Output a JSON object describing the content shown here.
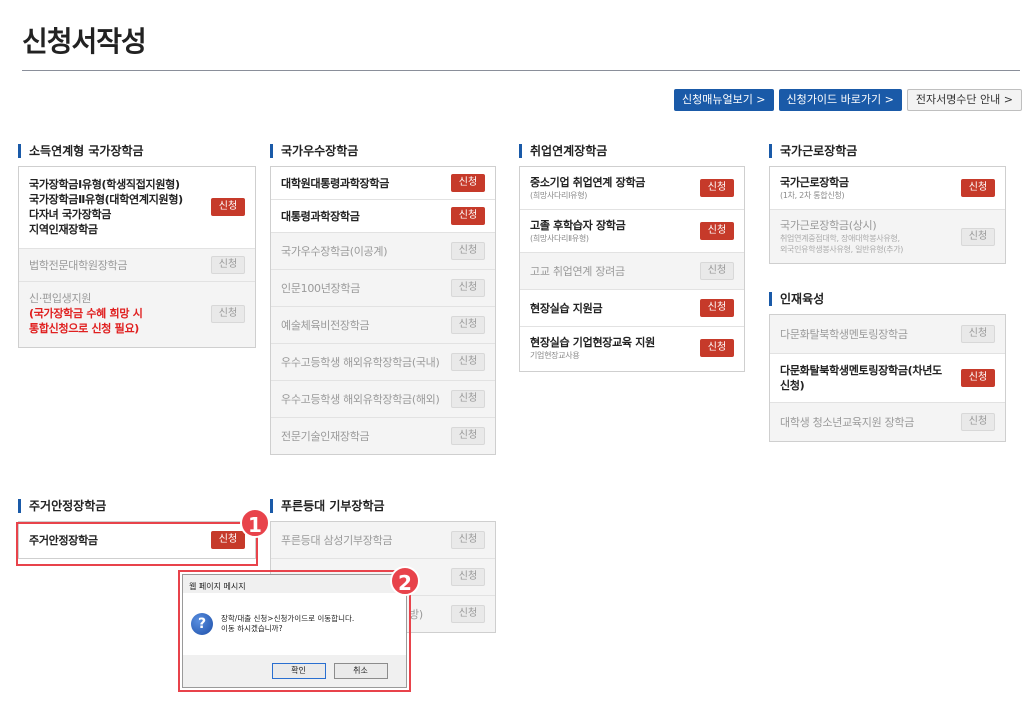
{
  "page": {
    "title": "신청서작성"
  },
  "top_buttons": [
    {
      "label": "신청매뉴얼보기 >",
      "style": "blue"
    },
    {
      "label": "신청가이드 바로가기 >",
      "style": "blue"
    },
    {
      "label": "전자서명수단 안내 >",
      "style": "gray"
    }
  ],
  "sections": {
    "income": {
      "title": "소득연계형 국가장학금",
      "main": {
        "label": "국가장학금Ⅰ유형(학생직접지원형)\n국가장학금Ⅱ유형(대학연계지원형)\n다자녀 국가장학금\n지역인재장학금",
        "button": "신청"
      },
      "law": {
        "label": "법학전문대학원장학금",
        "button": "신청"
      },
      "transfer": {
        "label": "신·편입생지원",
        "note": "(국가장학금 수혜 희망 시\n통합신청으로 신청 필요)",
        "button": "신청"
      }
    },
    "excellence": {
      "title": "국가우수장학금",
      "items": [
        {
          "label": "대학원대통령과학장학금",
          "button": "신청",
          "active": true
        },
        {
          "label": "대통령과학장학금",
          "button": "신청",
          "active": true
        },
        {
          "label": "국가우수장학금(이공계)",
          "button": "신청",
          "active": false
        },
        {
          "label": "인문100년장학금",
          "button": "신청",
          "active": false
        },
        {
          "label": "예술체육비전장학금",
          "button": "신청",
          "active": false
        },
        {
          "label": "우수고등학생 해외유학장학금(국내)",
          "button": "신청",
          "active": false
        },
        {
          "label": "우수고등학생 해외유학장학금(해외)",
          "button": "신청",
          "active": false
        },
        {
          "label": "전문기술인재장학금",
          "button": "신청",
          "active": false
        }
      ]
    },
    "employment": {
      "title": "취업연계장학금",
      "items": [
        {
          "label": "중소기업 취업연계 장학금",
          "sub": "(희망사다리Ⅰ유형)",
          "button": "신청",
          "active": true
        },
        {
          "label": "고졸 후학습자 장학금",
          "sub": "(희망사다리Ⅱ유형)",
          "button": "신청",
          "active": true
        },
        {
          "label": "고교 취업연계 장려금",
          "sub": "",
          "button": "신청",
          "active": false
        },
        {
          "label": "현장실습 지원금",
          "sub": "",
          "button": "신청",
          "active": true
        },
        {
          "label": "현장실습 기업현장교육 지원",
          "sub": "기업현장교사용",
          "button": "신청",
          "active": true
        }
      ]
    },
    "work": {
      "title": "국가근로장학금",
      "items": [
        {
          "label": "국가근로장학금",
          "sub": "(1차, 2차 통합신청)",
          "button": "신청",
          "active": true
        },
        {
          "label": "국가근로장학금(상시)",
          "sub": "취업연계중점대학, 장애대학봉사유형,\n외국인유학생봉사유형, 일반유형(추가)",
          "button": "신청",
          "active": false
        }
      ]
    },
    "talent": {
      "title": "인재육성",
      "items": [
        {
          "label": "다문화탈북학생멘토링장학금",
          "button": "신청",
          "active": false
        },
        {
          "label": "다문화탈북학생멘토링장학금(차년도\n신청)",
          "button": "신청",
          "active": true
        },
        {
          "label": "대학생 청소년교육지원 장학금",
          "button": "신청",
          "active": false
        }
      ]
    },
    "housing": {
      "title": "주거안정장학금",
      "items": [
        {
          "label": "주거안정장학금",
          "button": "신청",
          "active": true
        }
      ]
    },
    "donation": {
      "title": "푸른등대 기부장학금",
      "items": [
        {
          "label": "푸른등대 삼성기부장학금",
          "button": "신청",
          "active": false
        },
        {
          "label": "",
          "button": "신청",
          "active": false
        },
        {
          "label": "방)",
          "button": "신청",
          "active": false
        }
      ]
    }
  },
  "annotations": {
    "step1": "1",
    "step2": "2"
  },
  "dialog": {
    "title": "웹 페이지 메시지",
    "icon": "?",
    "message": "장학/대출 신청>신청가이드로 이동합니다.\n이동 하시겠습니까?",
    "ok": "확인",
    "cancel": "취소"
  },
  "colors": {
    "accent": "#1a5aa8",
    "apply_red": "#c63a2a",
    "highlight": "#e8434b",
    "note_red": "#e02020"
  }
}
